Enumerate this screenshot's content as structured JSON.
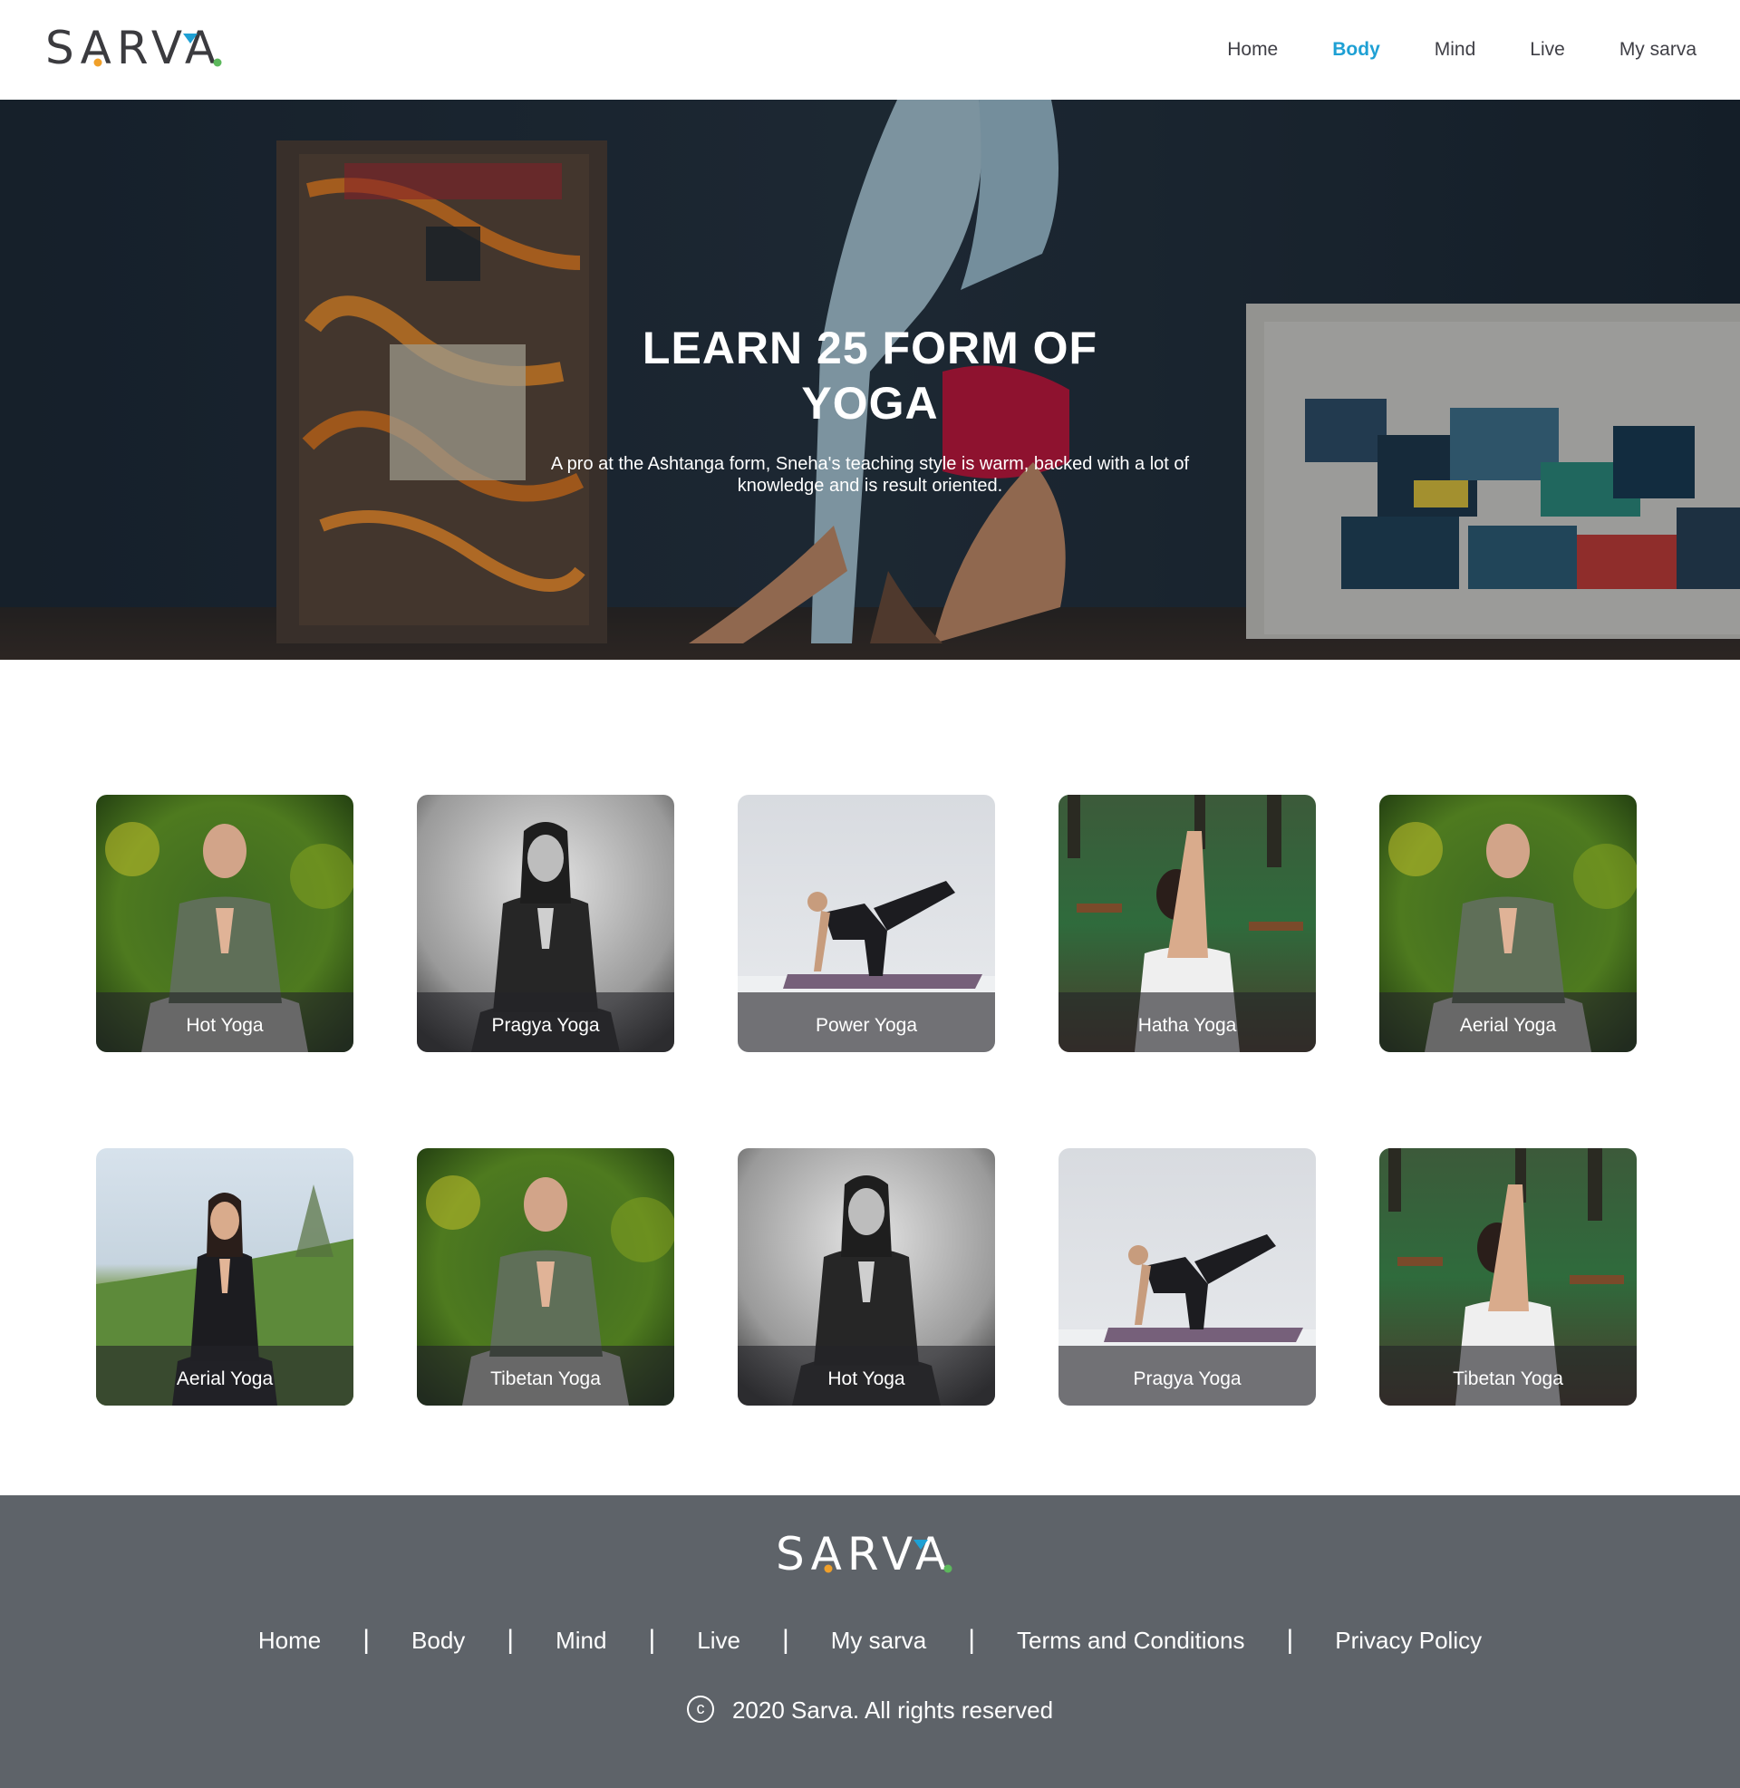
{
  "header": {
    "logo": "SARVA",
    "nav": [
      {
        "label": "Home",
        "active": false
      },
      {
        "label": "Body",
        "active": true
      },
      {
        "label": "Mind",
        "active": false
      },
      {
        "label": "Live",
        "active": false
      },
      {
        "label": "My sarva",
        "active": false
      }
    ]
  },
  "hero": {
    "title": "LEARN 25 FORM OF YOGA",
    "subtitle": "A pro at the Ashtanga form, Sneha's teaching style is warm, backed with a lot of knowledge and is result oriented."
  },
  "cards": [
    {
      "label": "Hot Yoga",
      "photo": "man-meditating-forest"
    },
    {
      "label": "Pragya Yoga",
      "photo": "woman-meditating-bw"
    },
    {
      "label": "Power Yoga",
      "photo": "woman-kneeling-leg-raise"
    },
    {
      "label": "Hatha Yoga",
      "photo": "woman-eagle-arms-garden"
    },
    {
      "label": "Aerial Yoga",
      "photo": "man-meditating-forest"
    },
    {
      "label": "Aerial Yoga",
      "photo": "woman-meditating-hill"
    },
    {
      "label": "Tibetan Yoga",
      "photo": "man-meditating-forest"
    },
    {
      "label": "Hot Yoga",
      "photo": "woman-meditating-bw"
    },
    {
      "label": "Pragya Yoga",
      "photo": "woman-kneeling-leg-raise"
    },
    {
      "label": "Tibetan Yoga",
      "photo": "woman-eagle-arms-garden"
    }
  ],
  "footer": {
    "logo": "SARVA",
    "links": [
      "Home",
      "Body",
      "Mind",
      "Live",
      "My sarva",
      "Terms and Conditions",
      "Privacy Policy"
    ],
    "copyright_symbol": "c",
    "copyright": "2020 Sarva. All rights reserved"
  },
  "colors": {
    "accent": "#1ea0d4",
    "logo_orange": "#f0a02a",
    "logo_blue": "#1ea0d4",
    "logo_green": "#5cb85c",
    "footer_bg": "#5e6369"
  }
}
